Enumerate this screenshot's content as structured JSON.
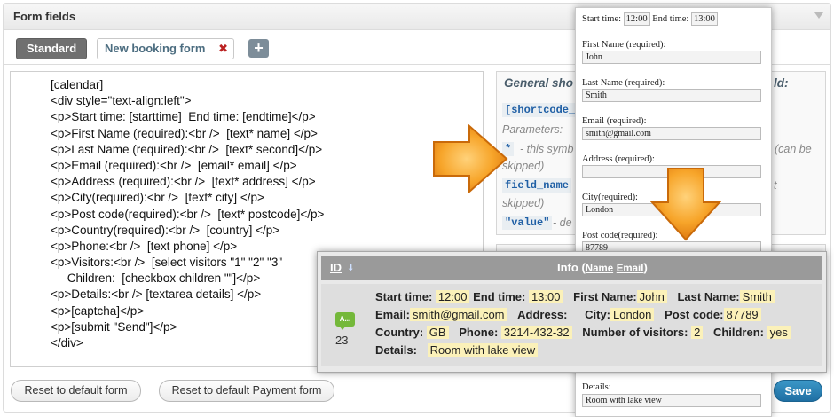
{
  "header": {
    "title": "Form fields"
  },
  "tabs": [
    {
      "label": "Standard"
    },
    {
      "label": "New booking form",
      "close": "✖"
    }
  ],
  "add_tab_label": "+",
  "code_lines": [
    "[calendar]",
    "<div style=\"text-align:left\">",
    "<p>Start time: [starttime]  End time: [endtime]</p>",
    "<p>First Name (required):<br />  [text* name] </p>",
    "<p>Last Name (required):<br />  [text* second]</p>",
    "<p>Email (required):<br />  [email* email] </p>",
    "<p>Address (required):<br />  [text* address] </p>",
    "<p>City(required):<br />  [text* city] </p>",
    "<p>Post code(required):<br />  [text* postcode]</p>",
    "<p>Country(required):<br />  [country] </p>",
    "<p>Phone:<br />  [text phone] </p>",
    "<p>Visitors:<br />  [select visitors \"1\" \"2\" \"3\"",
    "     Children:  [checkbox children \"\"]</p>",
    "<p>Details:<br /> [textarea details] </p>",
    "<p>[captcha]</p>",
    "<p>[submit \"Send\"]</p>",
    "</div>"
  ],
  "help": {
    "title": "General sho",
    "title_right": "ld:",
    "code1": "[shortcode_t",
    "params": "Parameters:",
    "star": "*",
    "star_desc": "- this symb",
    "can_be": "(can be",
    "skipped1": "skipped)",
    "field_name": "field_name",
    "not": "t",
    "skipped2": "skipped)",
    "value": "\"value\"",
    "value_desc": "- de"
  },
  "buttons": {
    "reset_form": "Reset to default form",
    "reset_payment": "Reset to default Payment form",
    "save": "Save"
  },
  "preview": {
    "start_label": "Start time:",
    "start_val": "12:00",
    "end_label": "End time:",
    "end_val": "13:00",
    "first_label": "First Name (required):",
    "first_val": "John",
    "last_label": "Last Name (required):",
    "last_val": "Smith",
    "email_label": "Email (required):",
    "email_val": "smith@gmail.com",
    "address_label": "Address (required):",
    "address_val": "",
    "city_label": "City(required):",
    "city_val": "London",
    "post_label": "Post code(required):",
    "post_val": "87789",
    "details_label": "Details:",
    "details_val": "Room with lake view"
  },
  "info": {
    "id_header": "ID",
    "title": "Info",
    "title_link1": "Name",
    "title_link2": "Email",
    "title_open": "(",
    "title_close": ")",
    "badge": "A...",
    "id": "23",
    "rows": {
      "start_label": "Start time:",
      "start_val": "12:00",
      "end_label": "End time:",
      "end_val": "13:00",
      "first_label": "First Name:",
      "first_val": "John",
      "last_label": "Last Name:",
      "last_val": "Smith",
      "email_label": "Email:",
      "email_val": "smith@gmail.com",
      "address_label": "Address:",
      "city_label": "City:",
      "city_val": "London",
      "post_label": "Post code:",
      "post_val": "87789",
      "country_label": "Country:",
      "country_val": "GB",
      "phone_label": "Phone:",
      "phone_val": "3214-432-32",
      "visitors_label": "Number of visitors:",
      "visitors_val": "2",
      "children_label": "Children:",
      "children_val": "yes",
      "details_label": "Details:",
      "details_val": "Room with lake view"
    }
  },
  "colors": {
    "accent": "#1f6fa3",
    "arrow": "#f39a1f",
    "highlight": "#fbf1b9"
  }
}
